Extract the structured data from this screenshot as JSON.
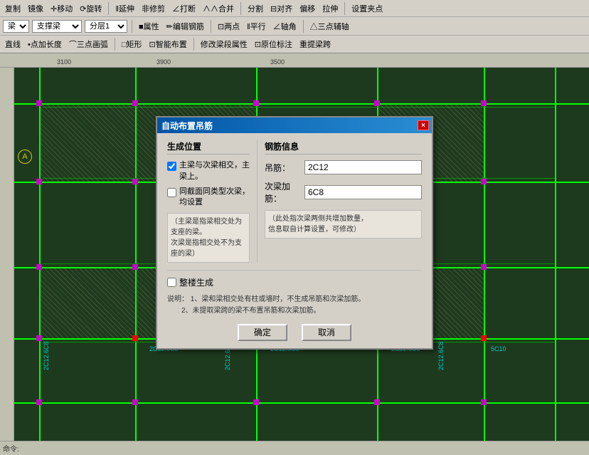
{
  "toolbar": {
    "row1": {
      "items": [
        "复制",
        "镜像",
        "移动",
        "旋转",
        "延伸",
        "修剪",
        "打断",
        "合并",
        "分割",
        "对齐",
        "偏移",
        "拉伸",
        "设置夹点"
      ]
    },
    "row2": {
      "beam_type": "梁",
      "support_type": "支撑梁",
      "layer": "分层1",
      "tools": [
        "属性",
        "编辑钢筋",
        "两点",
        "平行",
        "轴角",
        "三点辅轴"
      ]
    },
    "row3": {
      "items": [
        "直线",
        "点加长度",
        "三点画弧",
        "矩形",
        "智能布置",
        "修改梁段属性",
        "原位标注",
        "重提梁跨"
      ]
    }
  },
  "ruler": {
    "numbers": [
      "3100",
      "3900",
      "3500"
    ]
  },
  "dialog": {
    "title": "自动布置吊筋",
    "close_btn": "×",
    "section_generate": "生成位置",
    "section_rebar": "钢筋信息",
    "checkbox1": {
      "label": "主梁与次梁相交，主梁上。",
      "checked": true
    },
    "checkbox2": {
      "label": "同截面同类型次梁，均设置",
      "checked": false
    },
    "note1": "（主梁是指梁相交处为支座的梁。\n次梁是指相交处不为支座的梁）",
    "stirrup_label": "吊筋：",
    "stirrup_value": "2C12",
    "secondary_label": "次梁加筋：",
    "secondary_value": "6C8",
    "note2": "（此处指次梁两侧共增加数量，\n信息取自计算设置，可修改）",
    "whole_floor": {
      "label": "整楼生成",
      "checked": false
    },
    "note_title": "说明：",
    "note_content1": "1、梁和梁相交处有柱或墙时，不生成吊筋和次梁加筋。",
    "note_content2": "2、未提取梁跨的梁不布置吊筋和次梁加筋。",
    "btn_ok": "确定",
    "btn_cancel": "取消"
  },
  "cad_labels": {
    "label1": "2C12.6C8",
    "label2": "2C12.6C8",
    "label3": "2C12.6C8",
    "circle_a": "A",
    "dim1": "5C10"
  }
}
